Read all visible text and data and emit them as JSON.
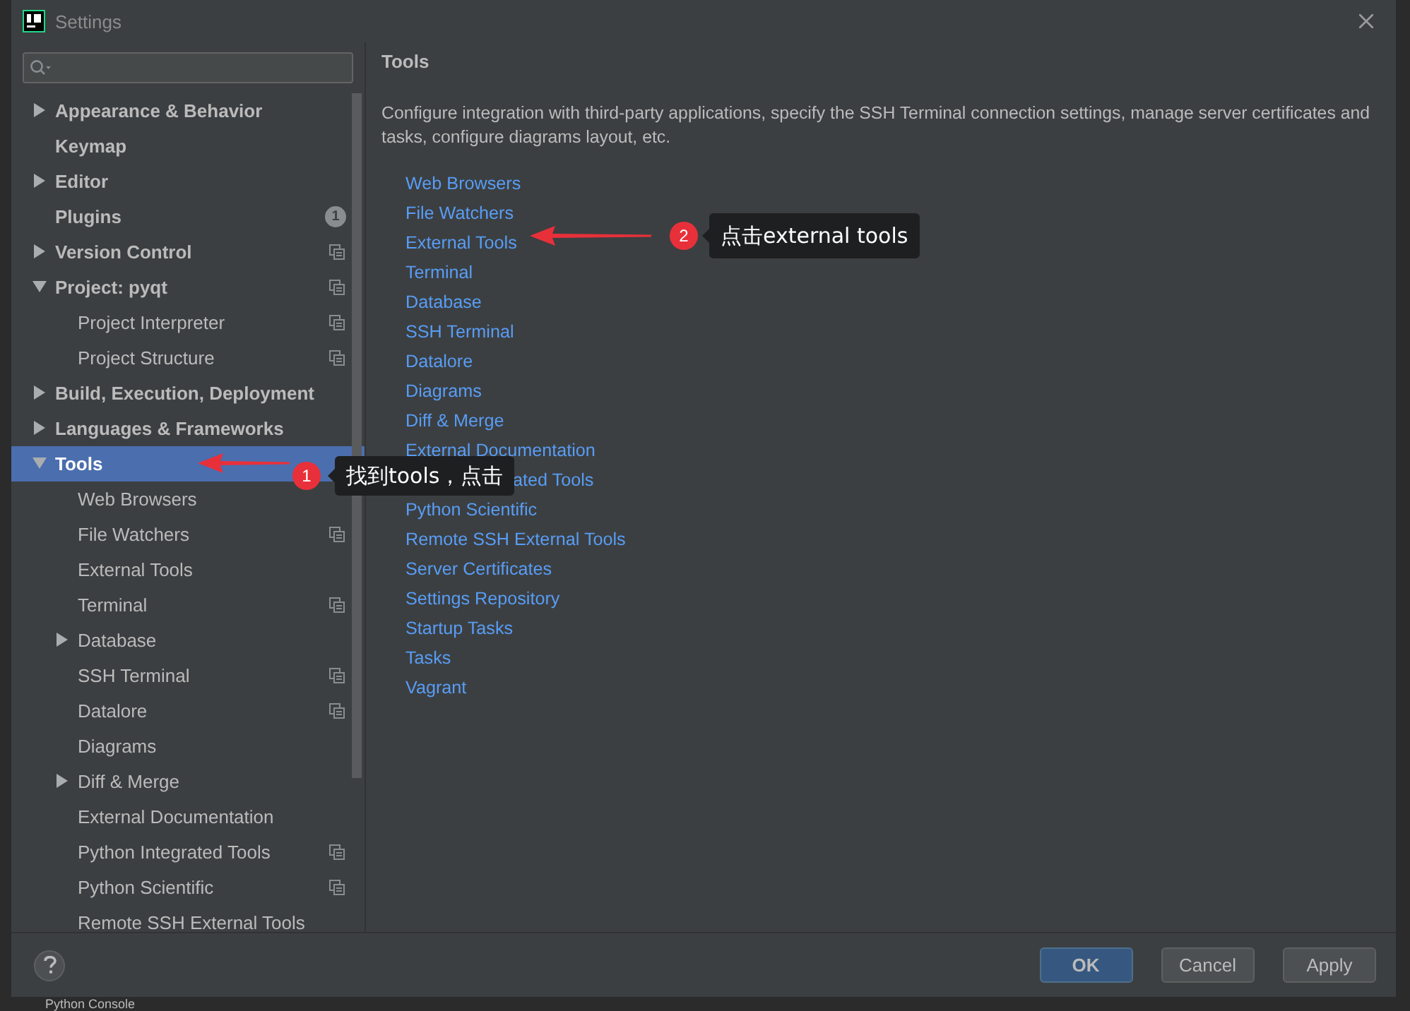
{
  "window": {
    "title": "Settings"
  },
  "sidebar": {
    "items": [
      {
        "label": "Appearance & Behavior",
        "expanded": false
      },
      {
        "label": "Keymap"
      },
      {
        "label": "Editor",
        "expanded": false
      },
      {
        "label": "Plugins",
        "badge": "1"
      },
      {
        "label": "Version Control",
        "expanded": false,
        "project_level": true
      },
      {
        "label": "Project: pyqt",
        "expanded": true,
        "project_level": true,
        "children": [
          {
            "label": "Project Interpreter",
            "project_level": true
          },
          {
            "label": "Project Structure",
            "project_level": true
          }
        ]
      },
      {
        "label": "Build, Execution, Deployment",
        "expanded": false
      },
      {
        "label": "Languages & Frameworks",
        "expanded": false
      },
      {
        "label": "Tools",
        "expanded": true,
        "selected": true,
        "children": [
          {
            "label": "Web Browsers",
            "selected": false
          },
          {
            "label": "File Watchers",
            "project_level": true,
            "selected": false
          },
          {
            "label": "External Tools",
            "selected": false
          },
          {
            "label": "Terminal",
            "project_level": true,
            "selected": false
          },
          {
            "label": "Database",
            "expanded": false,
            "selected": false
          },
          {
            "label": "SSH Terminal",
            "project_level": true,
            "selected": false
          },
          {
            "label": "Datalore",
            "project_level": true,
            "selected": false
          },
          {
            "label": "Diagrams",
            "selected": false
          },
          {
            "label": "Diff & Merge",
            "expanded": false,
            "selected": false
          },
          {
            "label": "External Documentation",
            "selected": false
          },
          {
            "label": "Python Integrated Tools",
            "project_level": true,
            "selected": false
          },
          {
            "label": "Python Scientific",
            "project_level": true,
            "selected": false
          },
          {
            "label": "Remote SSH External Tools",
            "selected": false
          }
        ]
      }
    ]
  },
  "content": {
    "title": "Tools",
    "description": "Configure integration with third-party applications, specify the SSH Terminal connection settings, manage server certificates and tasks, configure diagrams layout, etc.",
    "links": [
      {
        "label": "Web Browsers"
      },
      {
        "label": "File Watchers"
      },
      {
        "label": "External Tools"
      },
      {
        "label": "Terminal"
      },
      {
        "label": "Database"
      },
      {
        "label": "SSH Terminal"
      },
      {
        "label": "Datalore"
      },
      {
        "label": "Diagrams"
      },
      {
        "label": "Diff & Merge"
      },
      {
        "label": "External Documentation"
      },
      {
        "label": "ated Tools",
        "partly_covered": true
      },
      {
        "label": "Python Scientific"
      },
      {
        "label": "Remote SSH External Tools"
      },
      {
        "label": "Server Certificates"
      },
      {
        "label": "Settings Repository"
      },
      {
        "label": "Startup Tasks"
      },
      {
        "label": "Tasks"
      },
      {
        "label": "Vagrant"
      }
    ]
  },
  "buttons": [
    {
      "label": "OK",
      "kind": "primary"
    },
    {
      "label": "Cancel",
      "kind": "normal"
    },
    {
      "label": "Apply",
      "kind": "normal"
    }
  ],
  "annotations": [
    {
      "number": "1",
      "text": "找到tools，点击"
    },
    {
      "number": "2",
      "text": "点击external tools"
    }
  ],
  "background": {
    "tool_window": "Python Console"
  }
}
